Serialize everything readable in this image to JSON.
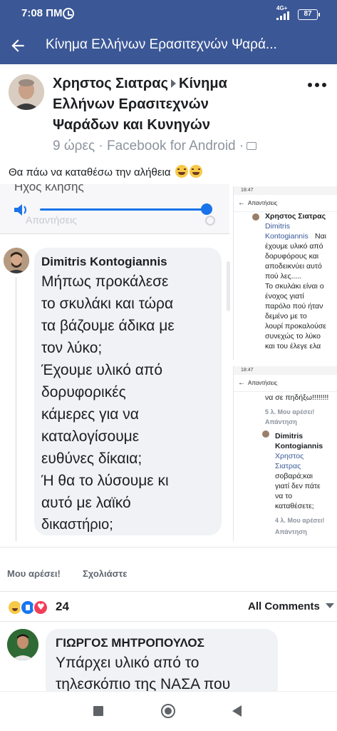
{
  "status_bar": {
    "time": "7:08 ΠΜ",
    "network": "4G+",
    "battery": "87"
  },
  "header": {
    "title": "Κίνημα Ελλήνων Ερασιτεχνών Ψαρά..."
  },
  "post": {
    "author_line_1": "Χρηστος Σιατρας",
    "author_line_1b": "Κίνημα",
    "author_line_2": "Ελλήνων Ερασιτεχνών",
    "author_line_3": "Ψαράδων και Κυνηγών",
    "meta": "9 ώρες · Facebook for Android ·",
    "text": "Θα πάω να καταθέσω την αλήθεια"
  },
  "shared_image": {
    "left_top": {
      "ringtone_label": "Ήχος κλήσης",
      "replies_label": "Απαντήσεις"
    },
    "comment": {
      "name": "Dimitris Kontogiannis",
      "lines": [
        "Μήπως προκάλεσε",
        "το σκυλάκι και τώρα",
        "τα βάζουμε άδικα με",
        "τον λύκο;",
        "Έχουμε υλικό από",
        "δορυφορικές",
        "κάμερες για να",
        "καταλογίσουμε",
        "ευθύνες δίκαια;",
        "Ή θα το λύσουμε κι",
        "αυτό με λαϊκό",
        "δικαστήριο;"
      ]
    },
    "right_panel_1": {
      "status_time": "18:47",
      "header": "Απαντήσεις",
      "name": "Χρηστος Σιατρας",
      "link_1": "Dimitris",
      "link_2": "Kontogiannis",
      "lines": [
        "Ναι",
        "έχουμε υλικό από",
        "δορυφόρους και",
        "αποδεικνύει αυτό",
        "πού λες.....",
        "Το σκυλάκι είναι ο",
        "ένοχος γιατί",
        "παρόλο πού ήταν",
        "δεμένο με το",
        "λουρί προκαλούσε",
        "συνεχώς το λύκο",
        "και του έλεγε ελα"
      ]
    },
    "right_panel_2": {
      "status_time": "18:47",
      "header": "Απαντήσεις",
      "first_line": "να σε πηδήξω!!!!!!!!",
      "stats_1": "5 λ.   Μου αρέσει!",
      "reply_1": "Απάντηση",
      "name_1": "Dimitris",
      "name_2": "Kontogiannis",
      "link_1": "Χρηστος",
      "link_2": "Σιατρας",
      "lines": [
        "σοβαρά;και",
        "γιατί δεν πάτε",
        "να το",
        "καταθέσετε;"
      ],
      "stats_2": "4 λ.   Μου αρέσει!",
      "reply_2": "Απάντηση"
    }
  },
  "actions": {
    "like": "Μου αρέσει!",
    "comment": "Σχολιάστε"
  },
  "reactions": {
    "count": "24",
    "sort_label": "All Comments"
  },
  "next_comment": {
    "name": "ΓΙΩΡΓΟΣ ΜΗΤΡΟΠΟΥΛΟΣ",
    "line_1": "Υπάρχει υλικό από το",
    "line_2": "τηλεσκόπιο της ΝΑΣΑ που"
  },
  "icons": {
    "back": "back-arrow-icon",
    "more": "more-dots-icon",
    "privacy": "public-icon",
    "volume": "volume-icon",
    "nav_recent": "square-icon",
    "nav_home": "circle-icon",
    "nav_back": "triangle-icon"
  },
  "colors": {
    "brand": "#3b5796",
    "link": "#385898",
    "bubble": "#f0f2f5",
    "meta": "#8d949e"
  }
}
